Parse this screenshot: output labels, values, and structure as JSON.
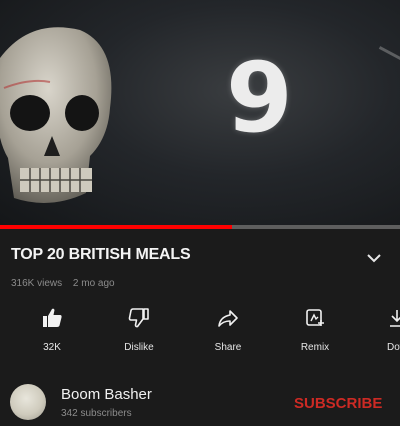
{
  "video": {
    "overlay_digit": "9",
    "progress": 0.58
  },
  "title": "TOP 20 BRITISH MEALS",
  "meta": {
    "views": "316K views",
    "age": "2 mo ago"
  },
  "actions": [
    {
      "label": "32K",
      "icon": "thumbs-up-icon"
    },
    {
      "label": "Dislike",
      "icon": "thumbs-down-icon"
    },
    {
      "label": "Share",
      "icon": "share-icon"
    },
    {
      "label": "Remix",
      "icon": "remix-icon"
    },
    {
      "label": "Dow",
      "icon": "download-icon"
    }
  ],
  "channel": {
    "name": "Boom Basher",
    "subscribers": "342 subscribers"
  },
  "subscribe_label": "SUBSCRIBE",
  "colors": {
    "background": "#1b1b1b",
    "progress_fill": "#ff0000",
    "subscribe": "#cc2a24"
  }
}
